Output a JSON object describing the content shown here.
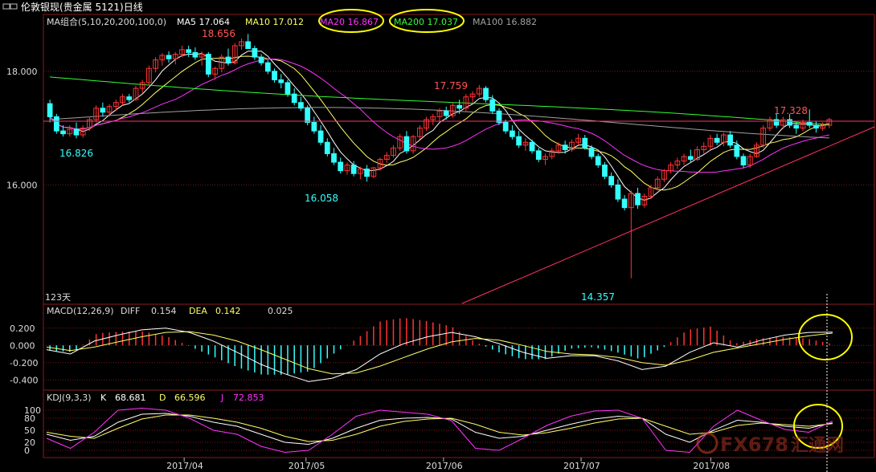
{
  "window": {
    "title": "伦敦银现(贵金属 5121)日线"
  },
  "main_panel": {
    "indicator_label": "MA组合(5,10,20,200,100,0)",
    "ma_values": [
      {
        "label": "MA5 17.064",
        "color": "#ffffff"
      },
      {
        "label": "MA10 17.012",
        "color": "#ffff66"
      },
      {
        "label": "MA20 16.867",
        "color": "#ff33ff"
      },
      {
        "label": "MA200 17.037",
        "color": "#33ff33"
      },
      {
        "label": "MA100 16.882",
        "color": "#a0a0a0"
      }
    ],
    "bar_count_label": "123天",
    "annotations": {
      "high1": "18.656",
      "high2": "17.759",
      "high3": "17.328",
      "low1": "16.826",
      "low2": "16.058",
      "low3": "14.357"
    }
  },
  "macd_panel": {
    "label": "MACD(12,26,9)",
    "diff_label": "DIFF",
    "diff_value": "0.154",
    "dea_label": "DEA",
    "dea_value": "0.142",
    "macd_value": "0.025"
  },
  "kdj_panel": {
    "label": "KDJ(9,3,3)",
    "k_label": "K",
    "k_value": "68.681",
    "d_label": "D",
    "d_value": "66.596",
    "j_label": "J",
    "j_value": "72.853"
  },
  "x_axis": {
    "ticks": [
      "2017/04",
      "2017/05",
      "2017/06",
      "2017/07",
      "2017/08"
    ]
  },
  "watermark": {
    "text": "FX678",
    "text2": "汇通网"
  },
  "colors": {
    "up": "#ff3333",
    "down": "#33ffff",
    "grid": "#7a1a1a",
    "circle": "#ffff00"
  },
  "chart_data": [
    {
      "type": "candlestick",
      "title": "伦敦银现(贵金属 5121)日线",
      "ylim": [
        13.9,
        19.0
      ],
      "y_ticks": [
        "18.000",
        "16.000"
      ],
      "x_ticks": [
        "2017/04",
        "2017/05",
        "2017/06",
        "2017/07",
        "2017/08"
      ],
      "ohlc": [
        [
          17.43,
          17.5,
          17.1,
          17.2
        ],
        [
          17.2,
          17.25,
          16.9,
          16.95
        ],
        [
          16.95,
          17.05,
          16.85,
          16.9
        ],
        [
          16.9,
          17.05,
          16.85,
          16.98
        ],
        [
          16.98,
          17.1,
          16.82,
          16.88
        ],
        [
          16.88,
          17.05,
          16.83,
          17.0
        ],
        [
          17.0,
          17.2,
          16.95,
          17.15
        ],
        [
          17.15,
          17.4,
          17.1,
          17.35
        ],
        [
          17.35,
          17.45,
          17.2,
          17.28
        ],
        [
          17.28,
          17.42,
          17.2,
          17.38
        ],
        [
          17.38,
          17.5,
          17.3,
          17.45
        ],
        [
          17.45,
          17.6,
          17.4,
          17.55
        ],
        [
          17.55,
          17.6,
          17.45,
          17.5
        ],
        [
          17.5,
          17.75,
          17.48,
          17.7
        ],
        [
          17.7,
          17.85,
          17.62,
          17.8
        ],
        [
          17.8,
          18.1,
          17.75,
          18.05
        ],
        [
          18.05,
          18.25,
          17.98,
          18.2
        ],
        [
          18.2,
          18.32,
          18.1,
          18.28
        ],
        [
          18.28,
          18.35,
          18.15,
          18.22
        ],
        [
          18.22,
          18.34,
          18.12,
          18.3
        ],
        [
          18.3,
          18.45,
          18.25,
          18.38
        ],
        [
          18.38,
          18.45,
          18.25,
          18.33
        ],
        [
          18.33,
          18.42,
          18.2,
          18.25
        ],
        [
          18.25,
          18.35,
          18.1,
          18.3
        ],
        [
          18.3,
          18.34,
          17.9,
          17.95
        ],
        [
          17.95,
          18.08,
          17.85,
          18.05
        ],
        [
          18.05,
          18.3,
          17.98,
          18.25
        ],
        [
          18.25,
          18.4,
          18.1,
          18.15
        ],
        [
          18.15,
          18.5,
          18.12,
          18.45
        ],
        [
          18.45,
          18.58,
          18.38,
          18.52
        ],
        [
          18.52,
          18.656,
          18.45,
          18.4
        ],
        [
          18.4,
          18.45,
          18.2,
          18.25
        ],
        [
          18.25,
          18.3,
          18.1,
          18.15
        ],
        [
          18.15,
          18.2,
          17.95,
          18.0
        ],
        [
          18.0,
          18.05,
          17.8,
          17.85
        ],
        [
          17.85,
          17.95,
          17.7,
          17.8
        ],
        [
          17.8,
          17.85,
          17.55,
          17.6
        ],
        [
          17.6,
          17.7,
          17.4,
          17.45
        ],
        [
          17.45,
          17.55,
          17.3,
          17.35
        ],
        [
          17.35,
          17.4,
          17.05,
          17.1
        ],
        [
          17.1,
          17.2,
          16.9,
          16.95
        ],
        [
          16.95,
          17.05,
          16.7,
          16.75
        ],
        [
          16.75,
          16.82,
          16.5,
          16.55
        ],
        [
          16.55,
          16.65,
          16.35,
          16.4
        ],
        [
          16.4,
          16.48,
          16.2,
          16.25
        ],
        [
          16.25,
          16.4,
          16.18,
          16.35
        ],
        [
          16.35,
          16.42,
          16.15,
          16.2
        ],
        [
          16.2,
          16.32,
          16.1,
          16.28
        ],
        [
          16.28,
          16.35,
          16.058,
          16.15
        ],
        [
          16.15,
          16.32,
          16.12,
          16.3
        ],
        [
          16.3,
          16.48,
          16.25,
          16.45
        ],
        [
          16.45,
          16.58,
          16.38,
          16.52
        ],
        [
          16.52,
          16.7,
          16.48,
          16.65
        ],
        [
          16.65,
          16.9,
          16.6,
          16.85
        ],
        [
          16.85,
          16.95,
          16.55,
          16.6
        ],
        [
          16.6,
          16.88,
          16.55,
          16.85
        ],
        [
          16.85,
          17.05,
          16.8,
          17.0
        ],
        [
          17.0,
          17.2,
          16.95,
          17.15
        ],
        [
          17.15,
          17.25,
          17.05,
          17.2
        ],
        [
          17.2,
          17.35,
          17.1,
          17.3
        ],
        [
          17.3,
          17.38,
          17.15,
          17.22
        ],
        [
          17.22,
          17.45,
          17.18,
          17.4
        ],
        [
          17.4,
          17.5,
          17.25,
          17.35
        ],
        [
          17.35,
          17.6,
          17.3,
          17.55
        ],
        [
          17.55,
          17.65,
          17.45,
          17.6
        ],
        [
          17.6,
          17.759,
          17.55,
          17.7
        ],
        [
          17.7,
          17.74,
          17.45,
          17.5
        ],
        [
          17.5,
          17.58,
          17.25,
          17.3
        ],
        [
          17.3,
          17.35,
          17.05,
          17.1
        ],
        [
          17.1,
          17.15,
          16.9,
          16.95
        ],
        [
          16.95,
          17.05,
          16.8,
          16.85
        ],
        [
          16.85,
          16.95,
          16.65,
          16.7
        ],
        [
          16.7,
          16.82,
          16.6,
          16.75
        ],
        [
          16.75,
          16.8,
          16.55,
          16.6
        ],
        [
          16.6,
          16.65,
          16.4,
          16.45
        ],
        [
          16.45,
          16.55,
          16.35,
          16.5
        ],
        [
          16.5,
          16.65,
          16.45,
          16.6
        ],
        [
          16.6,
          16.75,
          16.55,
          16.7
        ],
        [
          16.7,
          16.78,
          16.55,
          16.62
        ],
        [
          16.62,
          16.8,
          16.58,
          16.75
        ],
        [
          16.75,
          16.9,
          16.7,
          16.82
        ],
        [
          16.82,
          16.88,
          16.62,
          16.65
        ],
        [
          16.65,
          16.7,
          16.45,
          16.5
        ],
        [
          16.5,
          16.55,
          16.3,
          16.35
        ],
        [
          16.35,
          16.4,
          16.1,
          16.15
        ],
        [
          16.15,
          16.22,
          15.95,
          16.0
        ],
        [
          16.0,
          16.1,
          15.7,
          15.75
        ],
        [
          15.75,
          15.82,
          15.55,
          15.6
        ],
        [
          15.6,
          15.9,
          14.357,
          15.85
        ],
        [
          15.85,
          15.95,
          15.58,
          15.65
        ],
        [
          15.65,
          15.85,
          15.6,
          15.8
        ],
        [
          15.8,
          16.0,
          15.75,
          15.95
        ],
        [
          15.95,
          16.15,
          15.9,
          16.1
        ],
        [
          16.1,
          16.28,
          16.05,
          16.25
        ],
        [
          16.25,
          16.4,
          16.2,
          16.35
        ],
        [
          16.35,
          16.48,
          16.28,
          16.42
        ],
        [
          16.42,
          16.55,
          16.35,
          16.5
        ],
        [
          16.5,
          16.62,
          16.4,
          16.45
        ],
        [
          16.45,
          16.68,
          16.42,
          16.62
        ],
        [
          16.62,
          16.75,
          16.55,
          16.68
        ],
        [
          16.68,
          16.88,
          16.62,
          16.82
        ],
        [
          16.82,
          16.9,
          16.7,
          16.75
        ],
        [
          16.75,
          16.92,
          16.68,
          16.88
        ],
        [
          16.88,
          16.95,
          16.65,
          16.7
        ],
        [
          16.7,
          16.78,
          16.45,
          16.5
        ],
        [
          16.5,
          16.55,
          16.3,
          16.35
        ],
        [
          16.35,
          16.55,
          16.3,
          16.5
        ],
        [
          16.5,
          16.75,
          16.48,
          16.7
        ],
        [
          16.7,
          17.05,
          16.65,
          17.0
        ],
        [
          17.0,
          17.2,
          16.95,
          17.15
        ],
        [
          17.15,
          17.25,
          17.0,
          17.05
        ],
        [
          17.05,
          17.2,
          16.98,
          17.15
        ],
        [
          17.15,
          17.25,
          17.0,
          17.05
        ],
        [
          17.05,
          17.1,
          16.9,
          17.0
        ],
        [
          17.0,
          17.15,
          16.95,
          17.1
        ],
        [
          17.1,
          17.328,
          17.0,
          17.05
        ],
        [
          17.05,
          17.12,
          16.92,
          17.0
        ],
        [
          17.0,
          17.1,
          16.95,
          17.05
        ],
        [
          17.05,
          17.18,
          17.0,
          17.15
        ]
      ]
    },
    {
      "type": "line",
      "title": "MACD(12,26,9)",
      "y_ticks": [
        "0.200",
        "0.000",
        "-0.200",
        "-0.400"
      ],
      "ylim": [
        -0.5,
        0.3
      ],
      "series": [
        {
          "name": "DIFF",
          "color": "#ffffff",
          "values": [
            -0.05,
            -0.1,
            0.05,
            0.12,
            0.18,
            0.2,
            0.15,
            0.05,
            -0.08,
            -0.22,
            -0.33,
            -0.42,
            -0.38,
            -0.28,
            -0.1,
            0.02,
            0.1,
            0.15,
            0.1,
            0.02,
            -0.08,
            -0.15,
            -0.12,
            -0.12,
            -0.18,
            -0.28,
            -0.24,
            -0.08,
            0.03,
            -0.02,
            0.06,
            0.12,
            0.15,
            0.154
          ]
        },
        {
          "name": "DEA",
          "color": "#ffff66",
          "values": [
            -0.02,
            -0.06,
            -0.02,
            0.04,
            0.1,
            0.15,
            0.16,
            0.12,
            0.05,
            -0.05,
            -0.16,
            -0.27,
            -0.33,
            -0.32,
            -0.24,
            -0.14,
            -0.04,
            0.04,
            0.08,
            0.06,
            0.0,
            -0.07,
            -0.1,
            -0.11,
            -0.14,
            -0.2,
            -0.23,
            -0.17,
            -0.08,
            -0.03,
            0.02,
            0.07,
            0.11,
            0.142
          ]
        }
      ]
    },
    {
      "type": "line",
      "title": "KDJ(9,3,3)",
      "y_ticks": [
        "100",
        "80",
        "50",
        "20",
        "0"
      ],
      "ylim": [
        -10,
        110
      ],
      "series": [
        {
          "name": "K",
          "color": "#ffffff",
          "values": [
            40,
            25,
            35,
            70,
            90,
            92,
            85,
            70,
            60,
            40,
            20,
            15,
            30,
            55,
            75,
            80,
            82,
            78,
            45,
            30,
            35,
            50,
            65,
            78,
            85,
            80,
            40,
            20,
            50,
            75,
            70,
            60,
            55,
            68.681
          ]
        },
        {
          "name": "D",
          "color": "#ffff66",
          "values": [
            45,
            35,
            30,
            55,
            78,
            88,
            88,
            80,
            70,
            55,
            35,
            22,
            25,
            40,
            60,
            72,
            78,
            80,
            65,
            45,
            38,
            44,
            55,
            68,
            78,
            80,
            60,
            40,
            45,
            62,
            68,
            64,
            60,
            66.596
          ]
        },
        {
          "name": "J",
          "color": "#ff33ff",
          "values": [
            30,
            5,
            45,
            100,
            105,
            100,
            80,
            50,
            40,
            10,
            -5,
            0,
            40,
            85,
            100,
            95,
            90,
            74,
            5,
            0,
            30,
            62,
            85,
            98,
            100,
            80,
            0,
            -5,
            60,
            100,
            75,
            52,
            45,
            72.853
          ]
        }
      ]
    }
  ]
}
